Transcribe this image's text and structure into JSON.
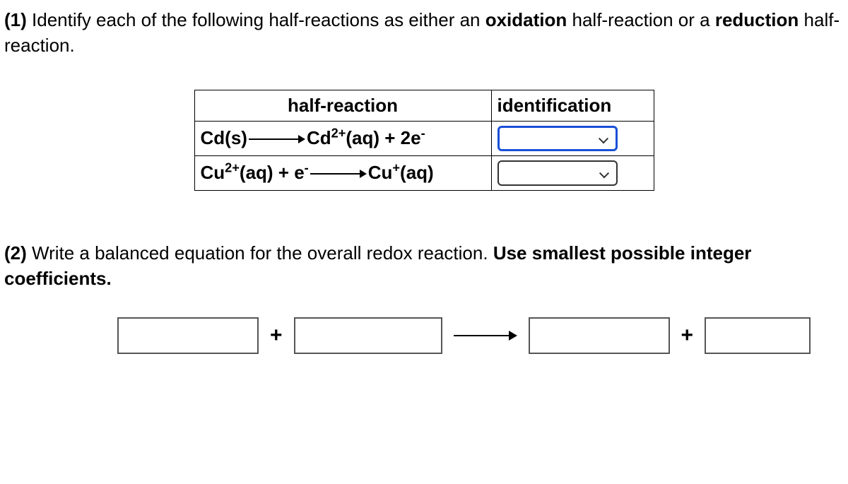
{
  "q1": {
    "number": "(1)",
    "text_part1": " Identify each of the following half-reactions as either an ",
    "bold1": "oxidation",
    "text_part2": " half-reaction or a ",
    "bold2": "reduction",
    "text_part3": " half-reaction."
  },
  "table": {
    "header_halfreaction": "half-reaction",
    "header_identification": "identification",
    "row1": {
      "r_cd": "Cd(s)",
      "r_cd2": "Cd",
      "r_cd2_sup": "2+",
      "r_cd2_tail": "(aq) + 2e",
      "r_cd2_sup2": "-"
    },
    "row2": {
      "r_cu2": "Cu",
      "r_cu2_sup": "2+",
      "r_cu2_mid": "(aq) + e",
      "r_cu2_sup2": "-",
      "r_cu": "Cu",
      "r_cu_sup": "+",
      "r_cu_tail": "(aq)"
    }
  },
  "q2": {
    "number": "(2)",
    "text_part1": " Write a balanced equation for the overall redox reaction. ",
    "bold1": "Use smallest possible integer coefficients."
  },
  "symbols": {
    "plus": "+"
  }
}
